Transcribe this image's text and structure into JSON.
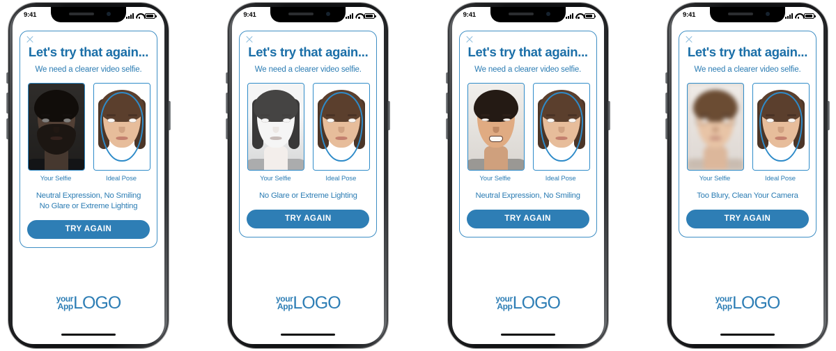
{
  "meta": {
    "screen_title": "Let's try that again...",
    "subtitle": "We need a clearer video selfie.",
    "selfie_label": "Your Selfie",
    "ideal_label": "Ideal Pose",
    "try_again_label": "TRY AGAIN",
    "close_icon": "close-x-icon",
    "logo_line1": "your",
    "logo_line2": "App",
    "logo_word": "LOGO",
    "accent_blue": "#2e7eb5",
    "title_blue": "#1b6fa8",
    "card_border": "#3e8ec4",
    "thumb_border": "#2e8bc9"
  },
  "status_bar": {
    "time": "9:41",
    "signal_icon": "cellular-signal-icon",
    "wifi_icon": "wifi-icon",
    "battery_icon": "battery-icon"
  },
  "phones": [
    {
      "id": "phone-1",
      "selfie_issue": "dark-underexposed-bearded-man",
      "reasons": [
        "Neutral Expression, No Smiling",
        "No Glare or Extreme Lighting"
      ]
    },
    {
      "id": "phone-2",
      "selfie_issue": "overexposed-glare-woman",
      "reasons": [
        "No Glare or Extreme Lighting"
      ]
    },
    {
      "id": "phone-3",
      "selfie_issue": "smiling-man",
      "reasons": [
        "Neutral Expression, No Smiling"
      ]
    },
    {
      "id": "phone-4",
      "selfie_issue": "blurry-man-with-glasses",
      "reasons": [
        "Too Blury, Clean Your Camera"
      ]
    }
  ]
}
